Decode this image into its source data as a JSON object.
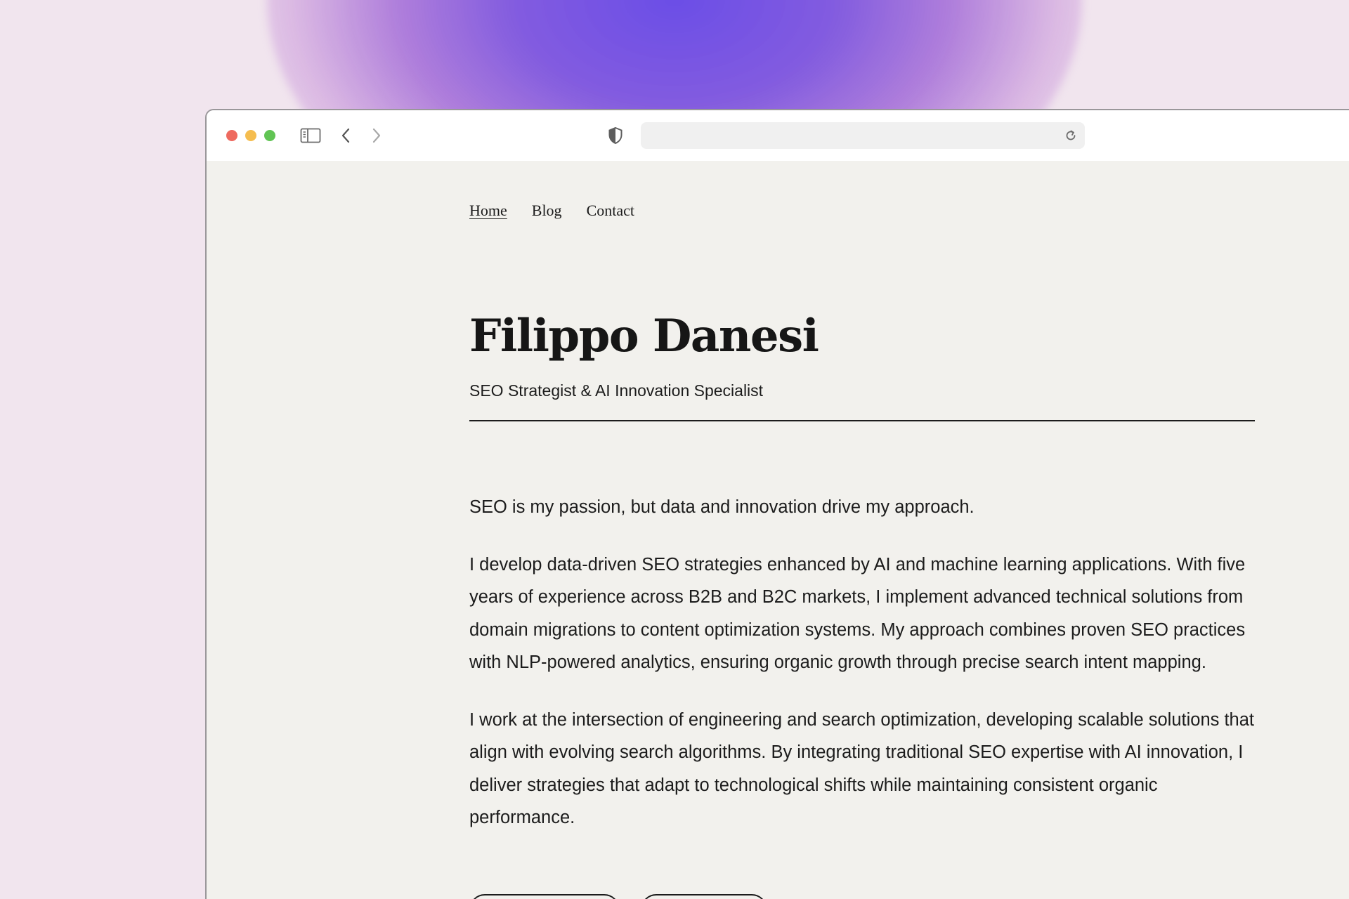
{
  "browser": {
    "url": "",
    "controls": {
      "sidebar_icon": "sidebar-icon",
      "back_icon": "chevron-left-icon",
      "forward_icon": "chevron-right-icon",
      "privacy_icon": "shield-icon",
      "reload_icon": "reload-icon"
    }
  },
  "nav": {
    "items": [
      {
        "label": "Home",
        "active": true
      },
      {
        "label": "Blog",
        "active": false
      },
      {
        "label": "Contact",
        "active": false
      }
    ]
  },
  "header": {
    "title": "Filippo Danesi",
    "subtitle": "SEO Strategist & AI Innovation Specialist"
  },
  "content": {
    "paragraphs": [
      "SEO is my passion, but data and innovation drive my approach.",
      "I develop data-driven SEO strategies enhanced by AI and machine learning applications. With five years of experience across B2B and B2C markets, I implement advanced technical solutions from domain migrations to content optimization systems. My approach combines proven SEO practices with NLP-powered analytics, ensuring organic growth through precise search intent mapping.",
      "I work at the intersection of engineering and search optimization, developing scalable solutions that align with evolving search algorithms. By integrating traditional SEO expertise with AI innovation, I deliver strategies that adapt to technological shifts while maintaining consistent organic performance."
    ]
  },
  "colors": {
    "background": "#f1e5ee",
    "glow": "#7b57e0",
    "page": "#f2f1ed",
    "text": "#1c1c1c",
    "traffic_red": "#ee6a5f",
    "traffic_yellow": "#f5bd4f",
    "traffic_green": "#61c454"
  }
}
